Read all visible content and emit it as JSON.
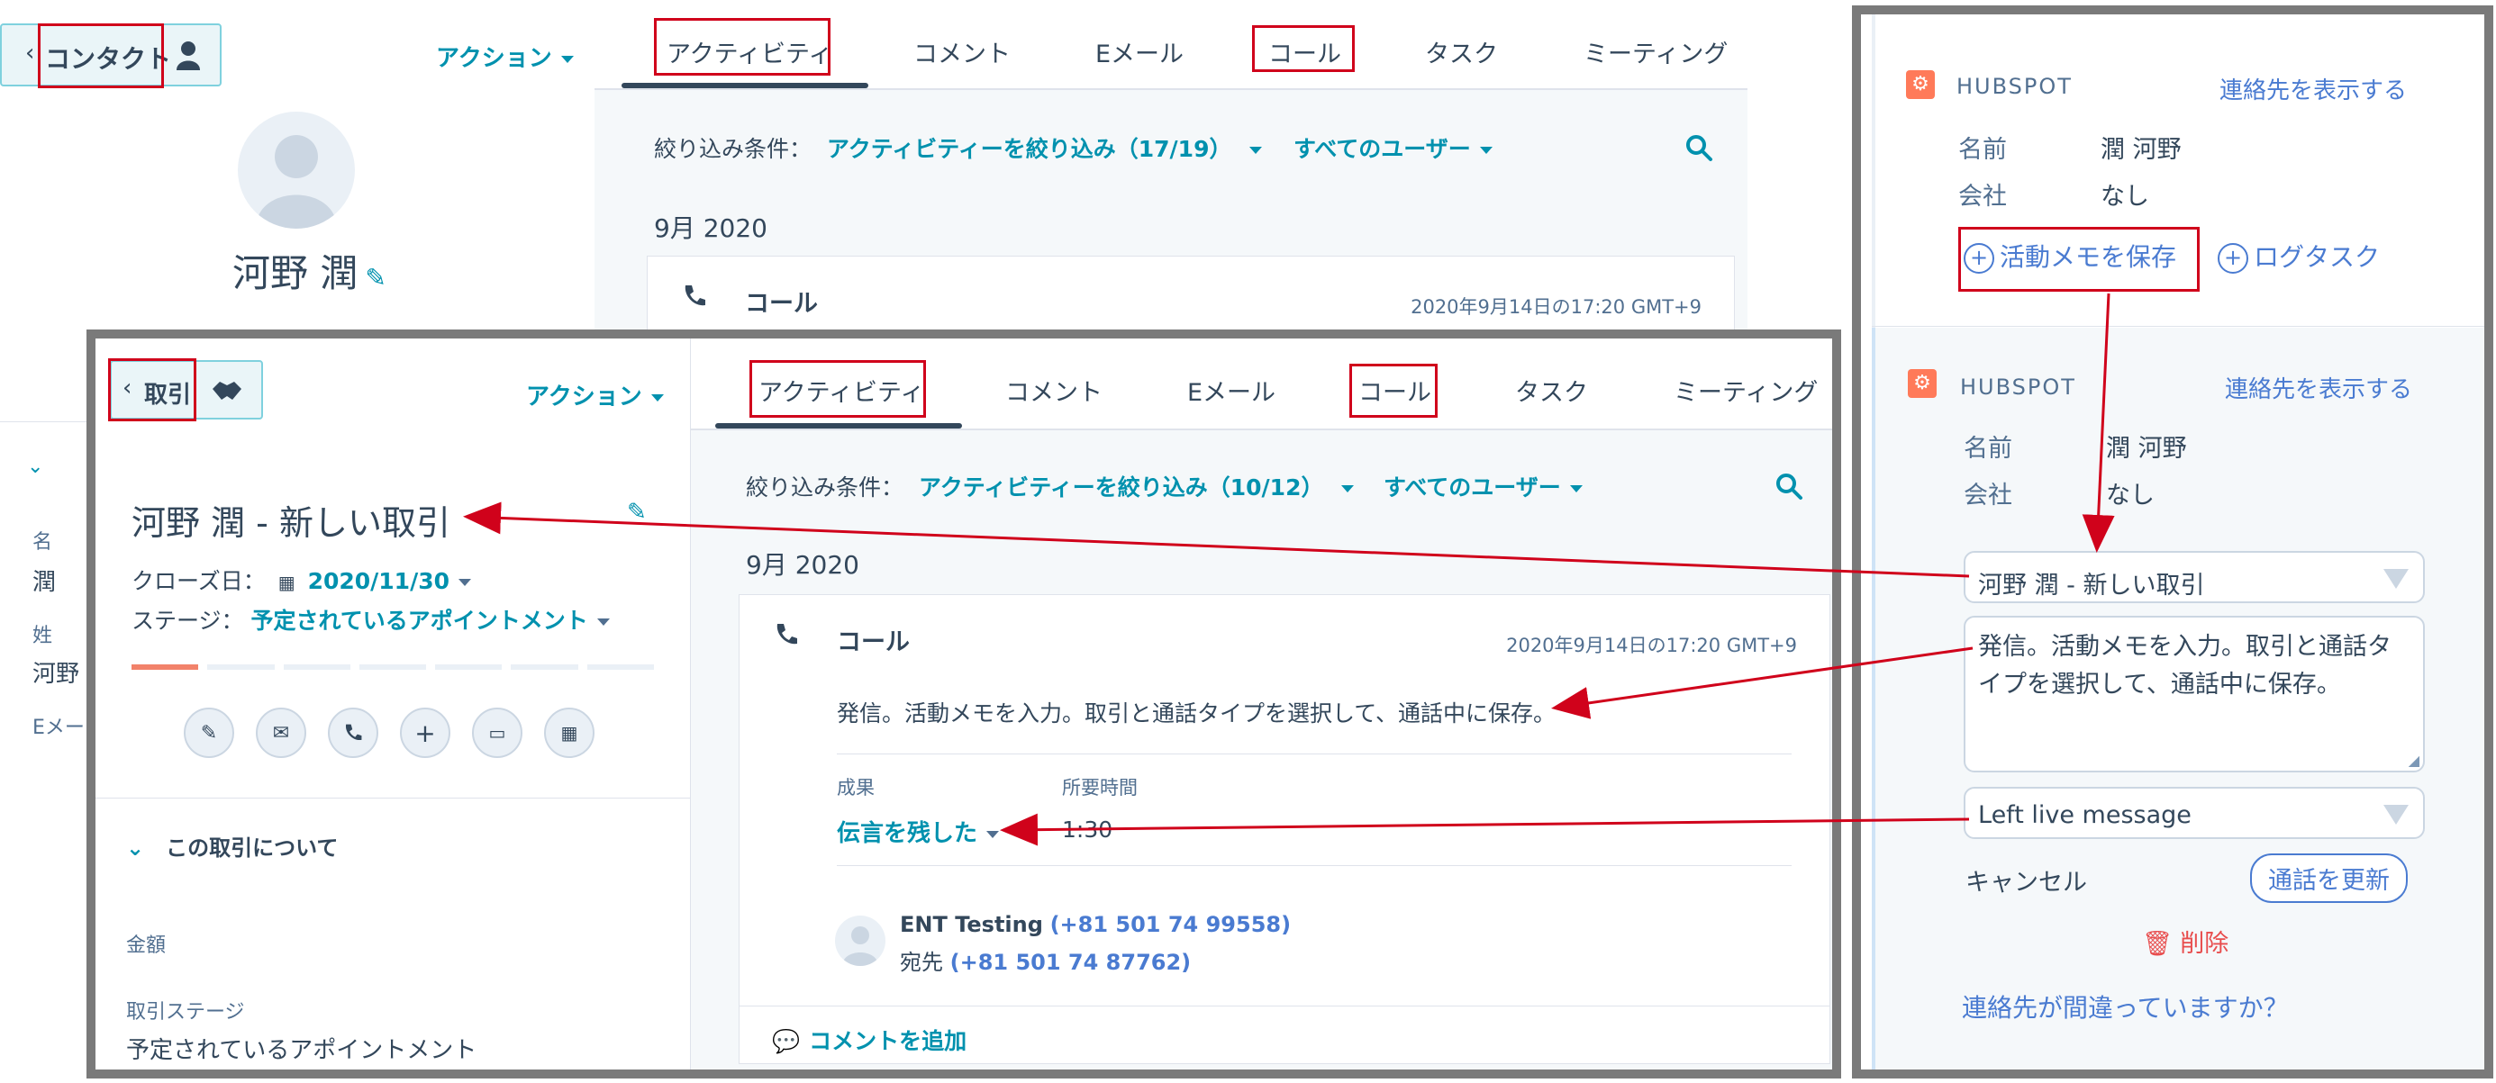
{
  "contact_panel": {
    "back_label": "コンタクト",
    "actions_label": "アクション",
    "name": "河野 潤",
    "partial_left_labels": [
      "名",
      "潤",
      "姓",
      "河野",
      "Eメー"
    ]
  },
  "contact_timeline": {
    "tabs": [
      "アクティビティ",
      "コメント",
      "Eメール",
      "コール",
      "タスク",
      "ミーティング"
    ],
    "filter_label": "絞り込み条件：",
    "filter_activities": "アクティビティーを絞り込み（17/19）",
    "filter_users": "すべてのユーザー",
    "month": "9月 2020",
    "call_title": "コール",
    "call_time": "2020年9月14日の17:20 GMT+9"
  },
  "deal_panel": {
    "back_label": "取引",
    "actions_label": "アクション",
    "deal_name": "河野 潤 - 新しい取引",
    "close_date_label": "クローズ日：",
    "close_date": "2020/11/30",
    "stage_label": "ステージ：",
    "stage_value": "予定されているアポイントメント",
    "about_title": "この取引について",
    "amount_label": "金額",
    "deal_stage_label": "取引ステージ",
    "deal_stage_value": "予定されているアポイントメント"
  },
  "deal_timeline": {
    "tabs": [
      "アクティビティ",
      "コメント",
      "Eメール",
      "コール",
      "タスク",
      "ミーティング"
    ],
    "filter_label": "絞り込み条件：",
    "filter_activities": "アクティビティーを絞り込み（10/12）",
    "filter_users": "すべてのユーザー",
    "month": "9月 2020",
    "call_title": "コール",
    "call_time": "2020年9月14日の17:20 GMT+9",
    "call_body": "発信。活動メモを入力。取引と通話タイプを選択して、通話中に保存。",
    "outcome_label": "成果",
    "duration_label": "所要時間",
    "outcome_value": "伝言を残した",
    "duration_value": "1:30",
    "from_name": "ENT Testing",
    "from_phone": "(+81 501 74 99558)",
    "to_label": "宛先",
    "to_phone": "(+81 501 74 87762)",
    "add_comment": "コメントを追加"
  },
  "hubspot_panel": {
    "brand": "HUBSPOT",
    "view_contact": "連絡先を表示する",
    "name_label": "名前",
    "name_value": "潤 河野",
    "company_label": "会社",
    "company_value": "なし",
    "save_note": "活動メモを保存",
    "log_task": "ログタスク",
    "deal_select": "河野 潤 - 新しい取引",
    "note_text": "発信。活動メモを入力。取引と通話タイプを選択して、通話中に保存。",
    "outcome_select": "Left live message",
    "cancel": "キャンセル",
    "update_call": "通話を更新",
    "delete": "削除",
    "wrong_contact": "連絡先が間違っていますか？"
  }
}
